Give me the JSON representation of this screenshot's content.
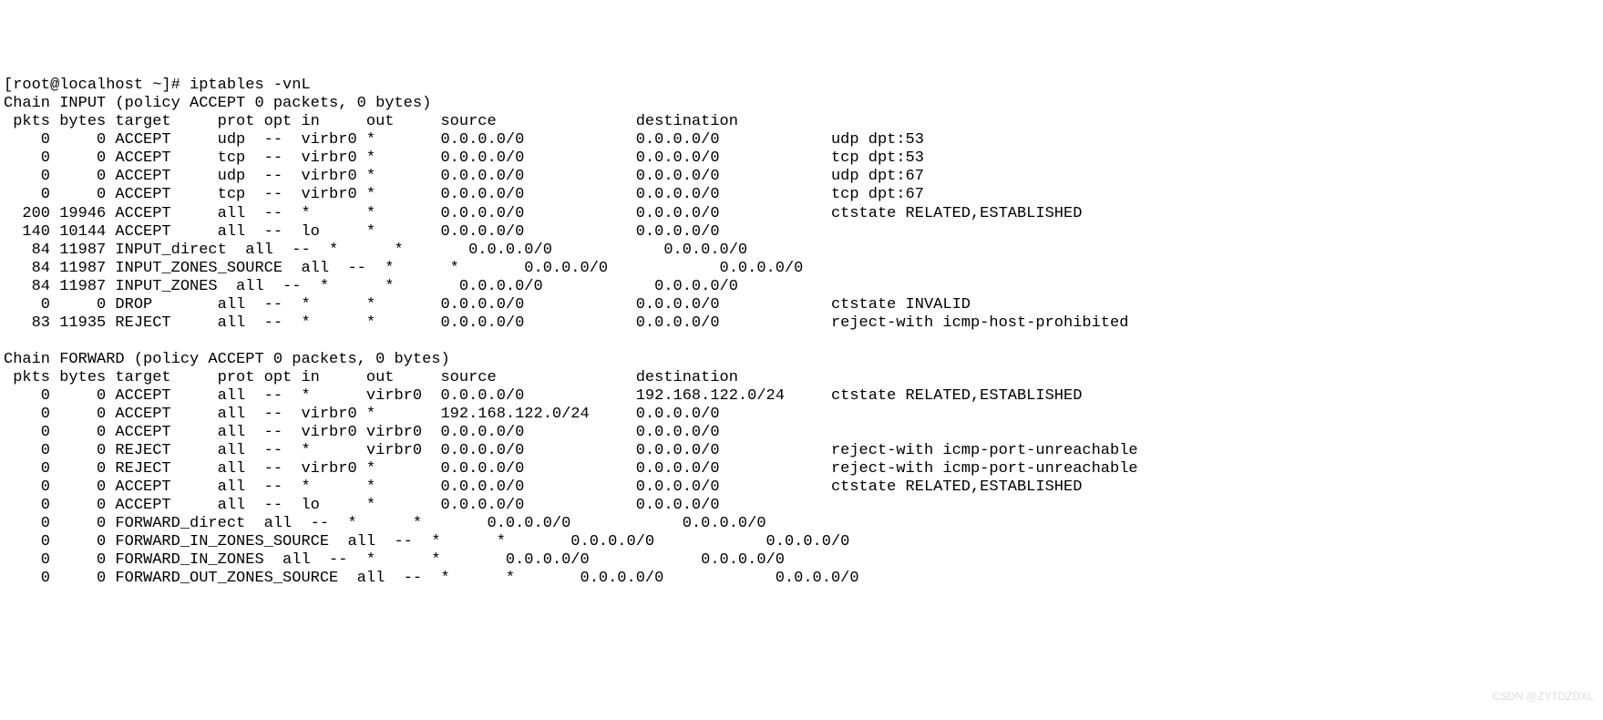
{
  "prompt": "[root@localhost ~]# iptables -vnL",
  "watermark": "CSDN @ZYTDZDXL",
  "chains": [
    {
      "name": "INPUT",
      "policy_line": "Chain INPUT (policy ACCEPT 0 packets, 0 bytes)",
      "header": " pkts bytes target     prot opt in     out     source               destination         ",
      "rules": [
        "    0     0 ACCEPT     udp  --  virbr0 *       0.0.0.0/0            0.0.0.0/0            udp dpt:53",
        "    0     0 ACCEPT     tcp  --  virbr0 *       0.0.0.0/0            0.0.0.0/0            tcp dpt:53",
        "    0     0 ACCEPT     udp  --  virbr0 *       0.0.0.0/0            0.0.0.0/0            udp dpt:67",
        "    0     0 ACCEPT     tcp  --  virbr0 *       0.0.0.0/0            0.0.0.0/0            tcp dpt:67",
        "  200 19946 ACCEPT     all  --  *      *       0.0.0.0/0            0.0.0.0/0            ctstate RELATED,ESTABLISHED",
        "  140 10144 ACCEPT     all  --  lo     *       0.0.0.0/0            0.0.0.0/0           ",
        "   84 11987 INPUT_direct  all  --  *      *       0.0.0.0/0            0.0.0.0/0           ",
        "   84 11987 INPUT_ZONES_SOURCE  all  --  *      *       0.0.0.0/0            0.0.0.0/0           ",
        "   84 11987 INPUT_ZONES  all  --  *      *       0.0.0.0/0            0.0.0.0/0           ",
        "    0     0 DROP       all  --  *      *       0.0.0.0/0            0.0.0.0/0            ctstate INVALID",
        "   83 11935 REJECT     all  --  *      *       0.0.0.0/0            0.0.0.0/0            reject-with icmp-host-prohibited"
      ]
    },
    {
      "name": "FORWARD",
      "policy_line": "Chain FORWARD (policy ACCEPT 0 packets, 0 bytes)",
      "header": " pkts bytes target     prot opt in     out     source               destination         ",
      "rules": [
        "    0     0 ACCEPT     all  --  *      virbr0  0.0.0.0/0            192.168.122.0/24     ctstate RELATED,ESTABLISHED",
        "    0     0 ACCEPT     all  --  virbr0 *       192.168.122.0/24     0.0.0.0/0           ",
        "    0     0 ACCEPT     all  --  virbr0 virbr0  0.0.0.0/0            0.0.0.0/0           ",
        "    0     0 REJECT     all  --  *      virbr0  0.0.0.0/0            0.0.0.0/0            reject-with icmp-port-unreachable",
        "    0     0 REJECT     all  --  virbr0 *       0.0.0.0/0            0.0.0.0/0            reject-with icmp-port-unreachable",
        "    0     0 ACCEPT     all  --  *      *       0.0.0.0/0            0.0.0.0/0            ctstate RELATED,ESTABLISHED",
        "    0     0 ACCEPT     all  --  lo     *       0.0.0.0/0            0.0.0.0/0           ",
        "    0     0 FORWARD_direct  all  --  *      *       0.0.0.0/0            0.0.0.0/0           ",
        "    0     0 FORWARD_IN_ZONES_SOURCE  all  --  *      *       0.0.0.0/0            0.0.0.0/0           ",
        "    0     0 FORWARD_IN_ZONES  all  --  *      *       0.0.0.0/0            0.0.0.0/0           ",
        "    0     0 FORWARD_OUT_ZONES_SOURCE  all  --  *      *       0.0.0.0/0            0.0.0.0/0           "
      ]
    }
  ]
}
